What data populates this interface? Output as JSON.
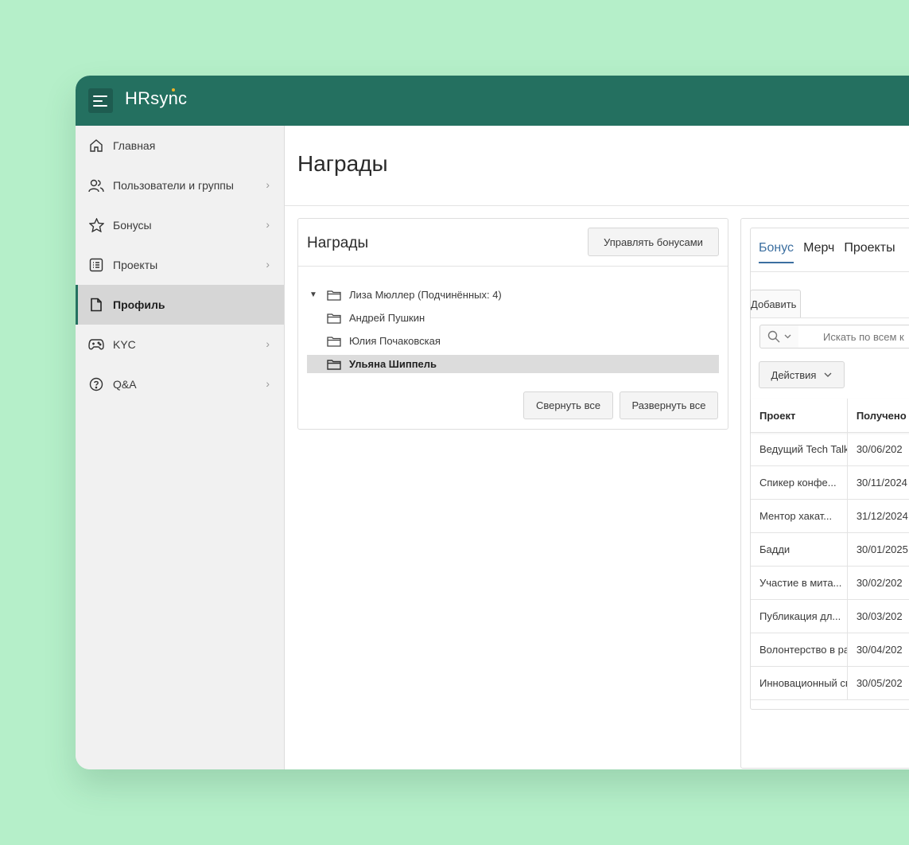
{
  "app": {
    "logo": "HRsync"
  },
  "sidebar": {
    "items": [
      {
        "label": "Главная",
        "icon": "home-icon",
        "chevron": false
      },
      {
        "label": "Пользователи и группы",
        "icon": "users-icon",
        "chevron": true
      },
      {
        "label": "Бонусы",
        "icon": "star-icon",
        "chevron": true
      },
      {
        "label": "Проекты",
        "icon": "list-icon",
        "chevron": true
      },
      {
        "label": "Профиль",
        "icon": "document-icon",
        "chevron": false,
        "active": true
      },
      {
        "label": "KYC",
        "icon": "gamepad-icon",
        "chevron": true
      },
      {
        "label": "Q&A",
        "icon": "question-icon",
        "chevron": true
      }
    ]
  },
  "main": {
    "title": "Награды"
  },
  "awards_panel": {
    "title": "Награды",
    "manage_label": "Управлять бонусами",
    "tree": [
      {
        "label": "Лиза Мюллер (Подчинённых: 4)",
        "expanded": true
      },
      {
        "label": "Андрей Пушкин"
      },
      {
        "label": "Юлия Почаковская"
      },
      {
        "label": "Ульяна Шиппель",
        "selected": true
      }
    ],
    "collapse_label": "Свернуть все",
    "expand_label": "Развернуть все"
  },
  "bonus_panel": {
    "tabs": [
      "Бонус",
      "Мерч",
      "Проекты"
    ],
    "active_tab": 0,
    "add_label": "Добавить",
    "search_placeholder": "Искать по всем к",
    "actions_label": "Действия",
    "columns": [
      "Проект",
      "Получено"
    ],
    "rows": [
      [
        "Ведущий Tech Talk",
        "30/06/202"
      ],
      [
        "Спикер конфе...",
        "30/11/2024"
      ],
      [
        "Ментор хакат...",
        "31/12/2024"
      ],
      [
        "Бадди",
        "30/01/2025"
      ],
      [
        "Участие в мита...",
        "30/02/202"
      ],
      [
        "Публикация дл...",
        "30/03/202"
      ],
      [
        "Волонтерство в рамках CSR",
        "30/04/202"
      ],
      [
        "Инновационный спринт",
        "30/05/202"
      ]
    ]
  },
  "colors": {
    "background": "#b5efc9",
    "topbar": "#247060",
    "accent": "#3c6fa0"
  }
}
